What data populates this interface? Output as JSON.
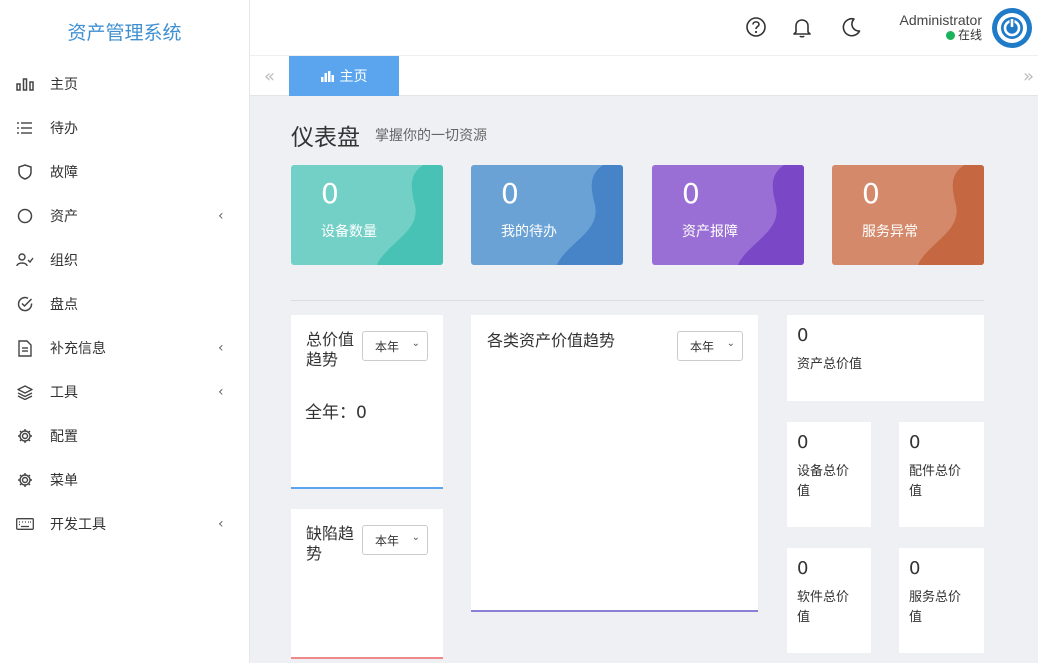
{
  "app": {
    "title": "资产管理系统"
  },
  "sidebar": {
    "items": [
      {
        "label": "主页",
        "icon": "bar-chart-icon"
      },
      {
        "label": "待办",
        "icon": "list-icon"
      },
      {
        "label": "故障",
        "icon": "shield-icon"
      },
      {
        "label": "资产",
        "icon": "circle-icon",
        "expand": "‹"
      },
      {
        "label": "组织",
        "icon": "user-check-icon"
      },
      {
        "label": "盘点",
        "icon": "check-circle-icon"
      },
      {
        "label": "补充信息",
        "icon": "file-icon",
        "expand": "‹"
      },
      {
        "label": "工具",
        "icon": "layers-icon",
        "expand": "‹"
      },
      {
        "label": "配置",
        "icon": "gear-icon"
      },
      {
        "label": "菜单",
        "icon": "gear-icon"
      },
      {
        "label": "开发工具",
        "icon": "keyboard-icon",
        "expand": "‹"
      }
    ]
  },
  "header": {
    "user_name": "Administrator",
    "user_status": "在线",
    "status_color": "#19b35a",
    "accent": "#1f7ac8"
  },
  "tabs": {
    "prev": "«",
    "next": "»",
    "active_label": "主页"
  },
  "page": {
    "title": "仪表盘",
    "subtitle": "掌握你的一切资源"
  },
  "stats": [
    {
      "value": "0",
      "label": "设备数量",
      "color": "#73d0c6"
    },
    {
      "value": "0",
      "label": "我的待办",
      "color": "#6aa2d6"
    },
    {
      "value": "0",
      "label": "资产报障",
      "color": "#9a6fd5"
    },
    {
      "value": "0",
      "label": "服务异常",
      "color": "#d48a6a"
    }
  ],
  "panels": {
    "total_value": {
      "title": "总价值趋势",
      "select": "本年",
      "summary": "全年：0"
    },
    "defect": {
      "title": "缺陷趋势",
      "select": "本年"
    },
    "asset_trend": {
      "title": "各类资产价值趋势",
      "select": "本年"
    }
  },
  "values": {
    "total": {
      "value": "0",
      "label": "资产总价值"
    },
    "device": {
      "value": "0",
      "label": "设备总价值"
    },
    "parts": {
      "value": "0",
      "label": "配件总价值"
    },
    "software": {
      "value": "0",
      "label": "软件总价值"
    },
    "service": {
      "value": "0",
      "label": "服务总价值"
    }
  }
}
